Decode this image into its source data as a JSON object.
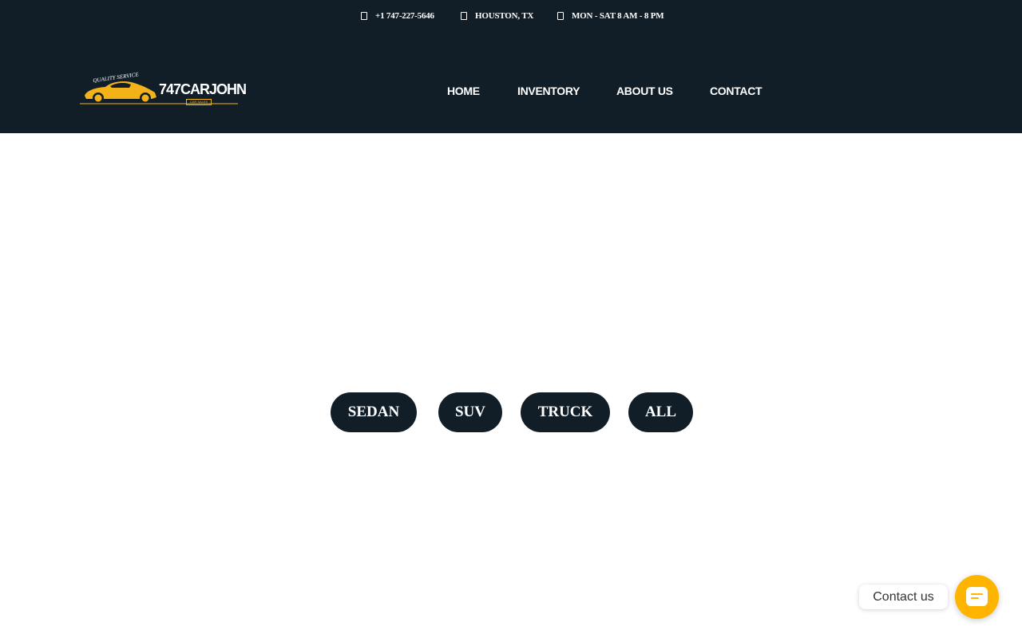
{
  "topbar": {
    "phone": "+1 747-227-5646",
    "location": "HOUSTON, TX",
    "hours": "MON - SAT 8 AM - 8 PM"
  },
  "logo": {
    "tagline": "QUALITY SERVICE",
    "brand": "747CARJOHN",
    "sub": "CAR SALES"
  },
  "nav": {
    "items": [
      {
        "label": "HOME"
      },
      {
        "label": "INVENTORY"
      },
      {
        "label": "ABOUT US"
      },
      {
        "label": "CONTACT"
      }
    ]
  },
  "filters": [
    {
      "label": "SEDAN"
    },
    {
      "label": "SUV"
    },
    {
      "label": "TRUCK"
    },
    {
      "label": "ALL"
    }
  ],
  "contact_widget": {
    "label": "Contact us"
  },
  "colors": {
    "header_bg": "#111e28",
    "accent": "#ffb400",
    "logo_yellow": "#f3b318",
    "button_bg": "#111e28"
  },
  "icons": {
    "phone": "phone-icon",
    "location": "map-marker-icon",
    "hours": "clock-icon",
    "chat": "chat-icon"
  }
}
